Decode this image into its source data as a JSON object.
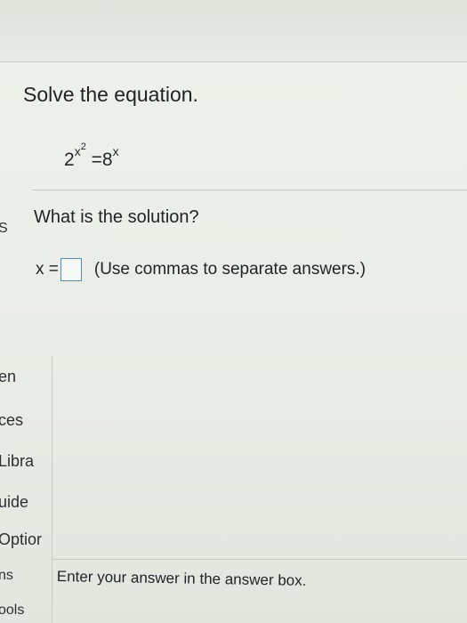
{
  "question": {
    "title": "Solve the equation.",
    "equation": {
      "base_left": "2",
      "exp_left": "x",
      "exp_left_power": "2",
      "equals": "=",
      "base_right": "8",
      "exp_right": "x"
    },
    "prompt": "What is the solution?",
    "answer_label": "x =",
    "answer_value": "",
    "answer_hint": "(Use commas to separate answers.)"
  },
  "sidebar": {
    "items": [
      "S",
      "en",
      "ces",
      "Libra",
      "uide",
      "Optior",
      "ns",
      "ools"
    ]
  },
  "status_bar": {
    "message": "Enter your answer in the answer box."
  },
  "colors": {
    "answer_box_border": "#4c8fc2",
    "background": "#e9ece6"
  }
}
